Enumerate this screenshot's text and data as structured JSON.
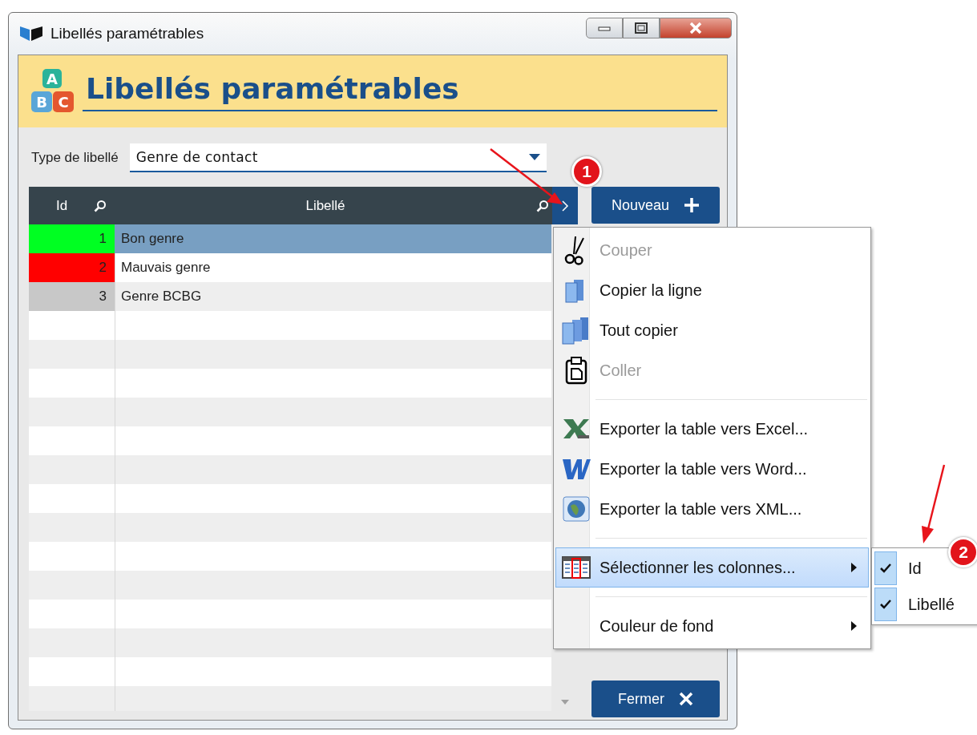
{
  "window": {
    "title": "Libellés paramétrables"
  },
  "header": {
    "title": "Libellés paramétrables",
    "logo_letters": [
      "A",
      "B",
      "C"
    ]
  },
  "filter": {
    "label": "Type de libellé",
    "value": "Genre de contact"
  },
  "table": {
    "columns": [
      {
        "label": "Id"
      },
      {
        "label": "Libellé"
      }
    ],
    "rows": [
      {
        "id": "1",
        "label": "Bon genre",
        "color": "#00ff22",
        "selected": true
      },
      {
        "id": "2",
        "label": "Mauvais genre",
        "color": "#ff0000",
        "selected": false
      },
      {
        "id": "3",
        "label": "Genre BCBG",
        "color": "#c8c8c8",
        "selected": false
      }
    ]
  },
  "buttons": [
    {
      "label": "Nouveau",
      "kind": "add"
    },
    {
      "label": "Fermer",
      "kind": "close"
    }
  ],
  "context_menu": {
    "items": [
      {
        "kind": "item",
        "label": "Couper",
        "disabled": true,
        "selected": false
      },
      {
        "kind": "item",
        "label": "Copier la ligne",
        "disabled": false,
        "selected": false
      },
      {
        "kind": "item",
        "label": "Tout copier",
        "disabled": false,
        "selected": false
      },
      {
        "kind": "item",
        "label": "Coller",
        "disabled": true,
        "selected": false
      },
      {
        "kind": "separator"
      },
      {
        "kind": "item",
        "label": "Exporter la table vers Excel...",
        "disabled": false,
        "selected": false
      },
      {
        "kind": "item",
        "label": "Exporter la table vers Word...",
        "disabled": false,
        "selected": false
      },
      {
        "kind": "item",
        "label": "Exporter la table vers XML...",
        "disabled": false,
        "selected": false
      },
      {
        "kind": "separator"
      },
      {
        "kind": "submenu",
        "label": "Sélectionner les colonnes...",
        "disabled": false,
        "selected": true
      },
      {
        "kind": "separator"
      },
      {
        "kind": "submenu",
        "label": "Couleur de fond",
        "disabled": false,
        "selected": false
      }
    ]
  },
  "submenu": {
    "items": [
      {
        "label": "Id",
        "checked": true
      },
      {
        "label": "Libellé",
        "checked": true
      }
    ]
  },
  "annotations": [
    {
      "label": "1"
    },
    {
      "label": "2"
    }
  ]
}
